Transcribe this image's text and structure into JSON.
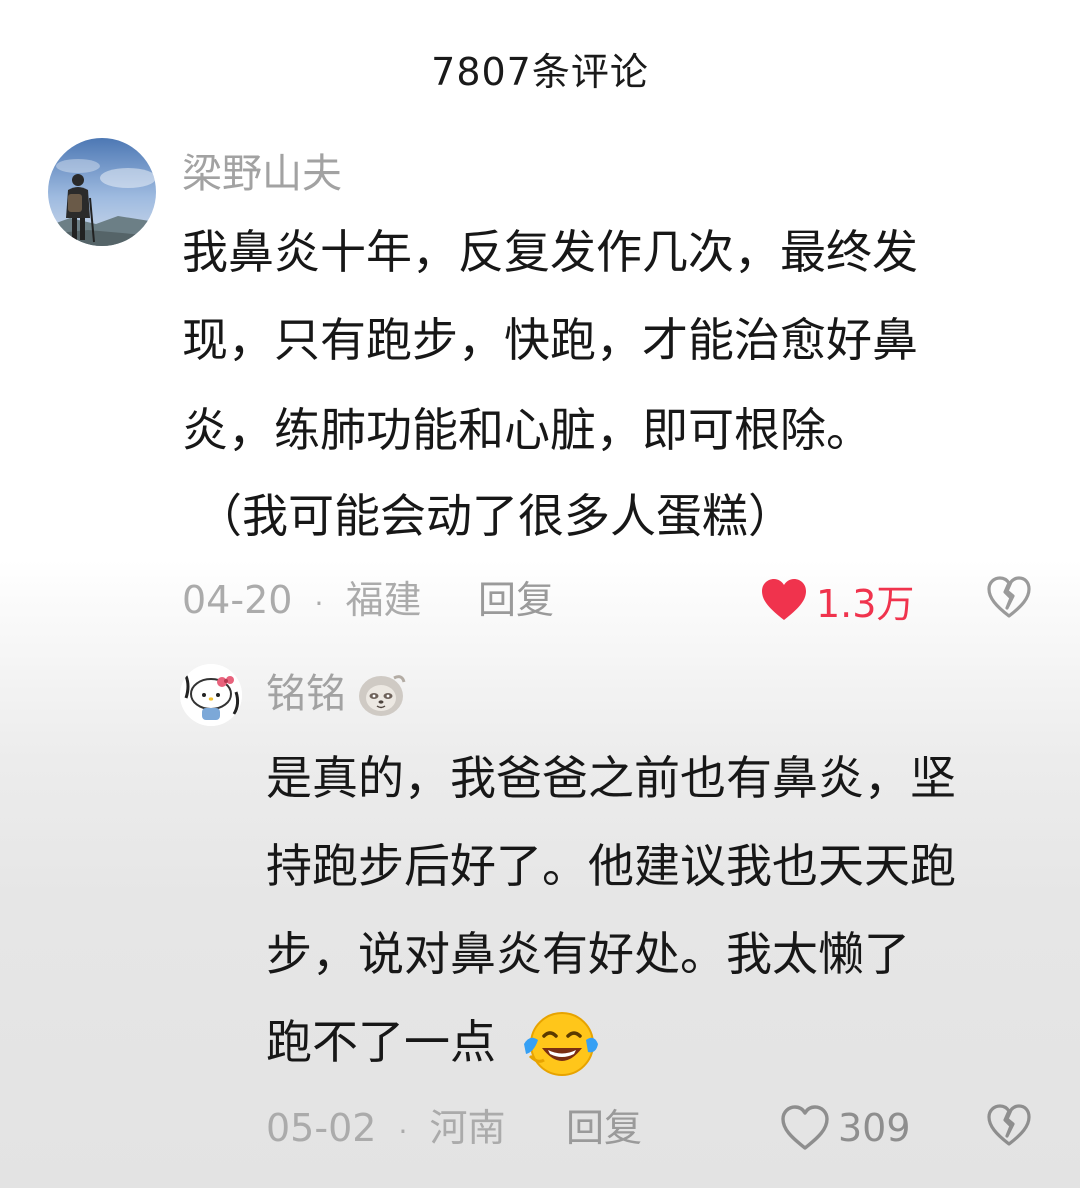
{
  "header": {
    "title": "7807条评论"
  },
  "comments": [
    {
      "username": "梁野山夫",
      "lines": [
        "我鼻炎十年，反复发作几次，最终发",
        "现，只有跑步，快跑，才能治愈好鼻",
        "炎，练肺功能和心脏，即可根除。",
        "（我可能会动了很多人蛋糕）"
      ],
      "date": "04-20",
      "location": "福建",
      "reply_label": "回复",
      "likes": "1.3万",
      "liked": true
    },
    {
      "username": "铭铭",
      "lines": [
        "是真的，我爸爸之前也有鼻炎，坚",
        "持跑步后好了。他建议我也天天跑",
        "步，说对鼻炎有好处。我太懒了",
        "跑不了一点"
      ],
      "date": "05-02",
      "location": "河南",
      "reply_label": "回复",
      "likes": "309",
      "liked": false
    }
  ],
  "separator": "·",
  "colors": {
    "like_red": "#f0334d",
    "meta_gray": "#ababab",
    "text": "#171717"
  },
  "icons": [
    "heart-icon",
    "dislike-icon",
    "laughing-emoji-icon",
    "sloth-badge-icon"
  ]
}
